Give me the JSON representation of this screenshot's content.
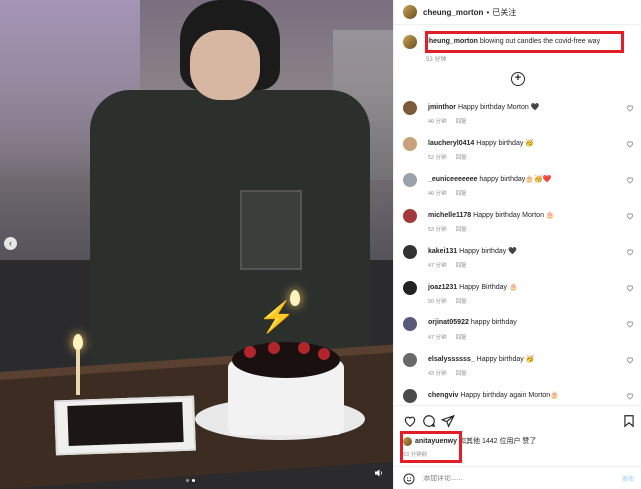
{
  "post": {
    "author": "cheung_morton",
    "header_separator": "•",
    "follow_status": "已关注",
    "caption_text": "blowing out candles the covid-free way",
    "caption_time": "53 分钟",
    "likes_user": "anitayuenwy",
    "likes_text": "和其他 1442 位用户 赞了",
    "post_time": "53 分钟前",
    "add_comment_placeholder": "添加评论......",
    "post_button": "发布",
    "highlight_color": "#e41e26"
  },
  "comments": [
    {
      "user": "jminthor",
      "text": "Happy birthday Morton 🖤",
      "time": "46 分钟",
      "reply": "回复"
    },
    {
      "user": "laucheryl0414",
      "text": "Happy birthday 🥳",
      "time": "52 分钟",
      "reply": "回复"
    },
    {
      "user": "_euniceeeeeee",
      "text": "happy birthday🎂🥳❤️",
      "time": "46 分钟",
      "reply": "回复"
    },
    {
      "user": "michelle1178",
      "text": "Happy birthday Morton 🎂",
      "time": "53 分钟",
      "reply": "回复"
    },
    {
      "user": "kakei131",
      "text": "Happy birthday 🖤",
      "time": "47 分钟",
      "reply": "回复"
    },
    {
      "user": "joaz1231",
      "text": "Happy Birthday 🎂",
      "time": "50 分钟",
      "reply": "回复"
    },
    {
      "user": "orjinat05922",
      "text": "happy birthday",
      "time": "47 分钟",
      "reply": "回复"
    },
    {
      "user": "elsalyssssss_",
      "text": "Happy birthday 🥳",
      "time": "43 分钟",
      "reply": "回复"
    },
    {
      "user": "chengviv",
      "text": "Happy birthday again Morton🎂",
      "time": "43 分钟",
      "reply": "回复"
    }
  ],
  "avatar_colors": [
    "#7c5a3a",
    "#c9a27a",
    "#9aa3ad",
    "#a33a3a",
    "#333333",
    "#222222",
    "#5a5a7a",
    "#6a6a6a",
    "#4a4a4a"
  ]
}
